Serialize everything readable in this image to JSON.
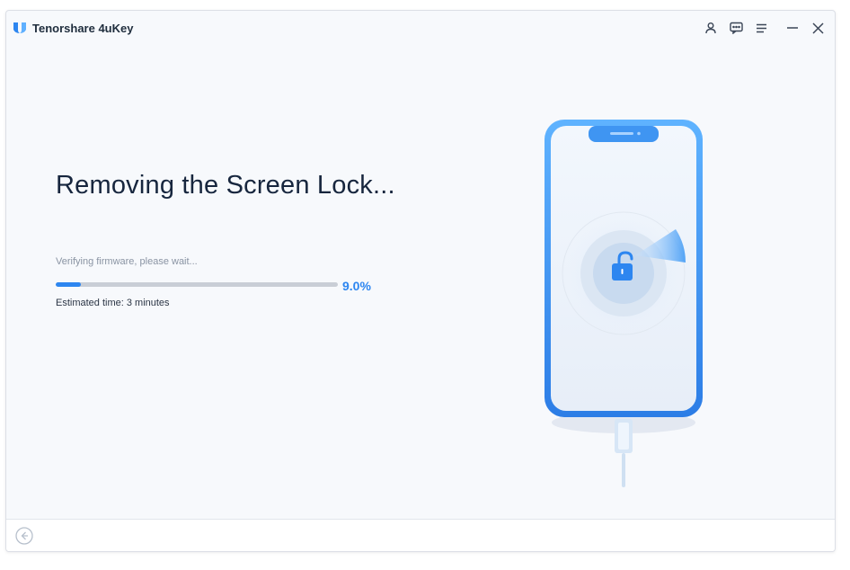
{
  "app": {
    "title": "Tenorshare 4uKey"
  },
  "titlebar": {
    "icons": [
      "account-icon",
      "feedback-icon",
      "menu-icon",
      "minimize-icon",
      "close-icon"
    ]
  },
  "main": {
    "heading": "Removing the Screen Lock...",
    "status_text": "Verifying firmware, please wait...",
    "progress_percent": 9.0,
    "progress_label": "9.0%",
    "estimate_text": "Estimated time: 3 minutes"
  },
  "illustration": {
    "icons": [
      "phone-icon",
      "unlock-icon",
      "usb-cable-icon"
    ]
  },
  "footer": {
    "icons": [
      "back-arrow-icon"
    ]
  },
  "colors": {
    "accent": "#2d86f0",
    "heading": "#17263e",
    "track": "#c9ced6",
    "background": "#f7f9fc"
  }
}
